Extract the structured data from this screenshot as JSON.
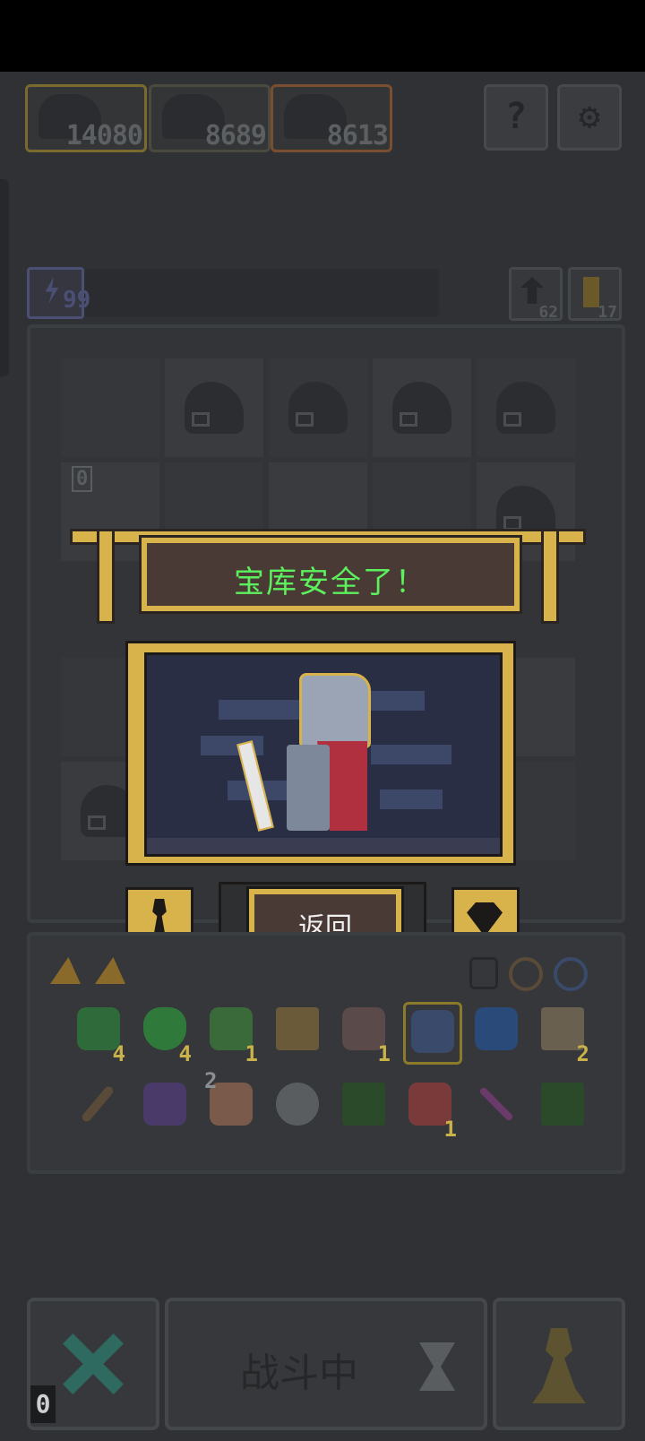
{
  "resources": [
    {
      "name": "monster-cost-1",
      "value": "14080",
      "color": "#c6a640"
    },
    {
      "name": "monster-cost-2",
      "value": "8689",
      "color": "#8a8f94"
    },
    {
      "name": "monster-cost-3",
      "value": "8613",
      "color": "#c8763a"
    }
  ],
  "top_buttons": {
    "help": "?",
    "settings": "⚙"
  },
  "energy": {
    "value": "99",
    "icon": "lightning-icon"
  },
  "counters": {
    "swap": "62",
    "key": "17"
  },
  "board": {
    "marker": "0"
  },
  "banner": {
    "text": "宝库安全了！"
  },
  "portrait": {
    "subject": "knight-icon"
  },
  "actions": {
    "back_label": "返回"
  },
  "inventory": {
    "row1": [
      {
        "icon": "green-knight-icon",
        "count": "4"
      },
      {
        "icon": "green-gem-icon",
        "count": "4"
      },
      {
        "icon": "green-knight-icon",
        "count": "1"
      },
      {
        "icon": "trident-icon",
        "count": ""
      },
      {
        "icon": "crossbow-icon",
        "count": "1"
      },
      {
        "icon": "crown-icon",
        "count": ""
      },
      {
        "icon": "blue-flame-icon",
        "count": ""
      },
      {
        "icon": "scroll-icon",
        "count": "2"
      }
    ],
    "row2": [
      {
        "icon": "dagger-icon",
        "count": ""
      },
      {
        "icon": "bat-icon",
        "count": ""
      },
      {
        "icon": "hand-icon",
        "count": "2"
      },
      {
        "icon": "mirror-icon",
        "count": ""
      },
      {
        "icon": "green-card-icon",
        "count": ""
      },
      {
        "icon": "red-creature-icon",
        "count": "1"
      },
      {
        "icon": "arrow-icon",
        "count": ""
      },
      {
        "icon": "green-card-icon",
        "count": ""
      }
    ]
  },
  "bottom": {
    "fight_label": "战斗中",
    "zero_tag": "0"
  }
}
